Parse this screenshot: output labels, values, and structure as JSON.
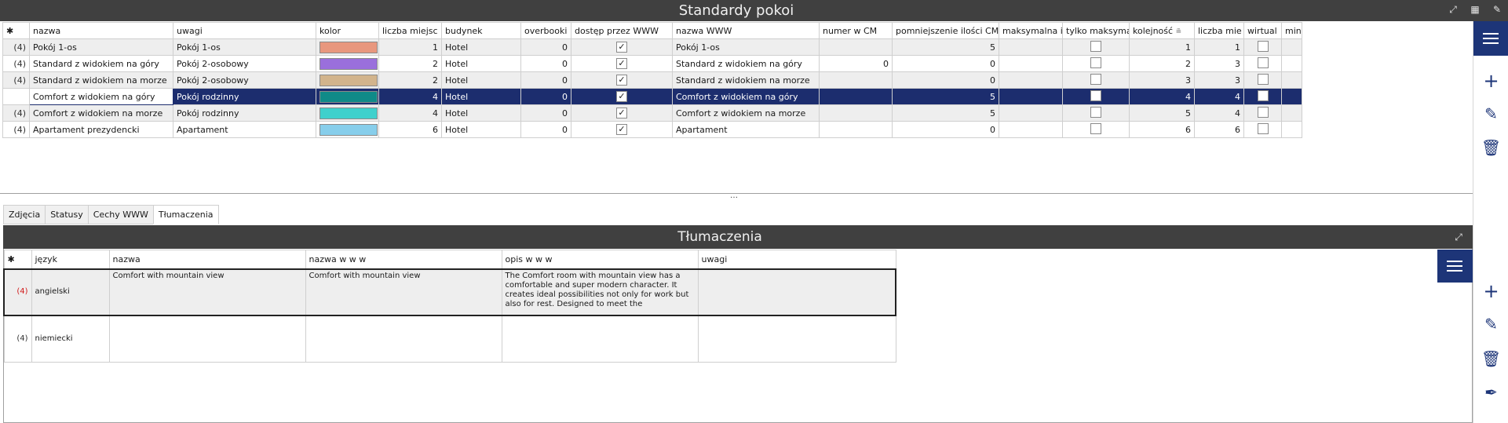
{
  "window": {
    "title": "Standardy pokoi",
    "icons": [
      "expand-icon",
      "grid-settings-icon",
      "tools-icon"
    ]
  },
  "grid": {
    "columns": [
      "nazwa",
      "uwagi",
      "kolor",
      "liczba miejsc",
      "budynek",
      "overbooki",
      "dostęp przez WWW",
      "nazwa WWW",
      "numer w CM",
      "pomniejszenie ilości CM",
      "maksymalna i",
      "tylko maksyma",
      "kolejność",
      "liczba mie",
      "wirtual",
      "min"
    ],
    "row_id_label": "(4)",
    "check_mark": "✓",
    "rows": [
      {
        "nazwa": "Pokój 1-os",
        "uwagi": "Pokój 1-os",
        "kolor": "#e8977e",
        "liczba_miejsc": "1",
        "budynek": "Hotel",
        "overbooki": "0",
        "dostep_www": true,
        "nazwa_www": "Pokój 1-os",
        "numer_cm": "",
        "pomniejszenie_cm": "5",
        "maksymalna": "",
        "tylko_maks": false,
        "kolejnosc": "1",
        "liczba_mie": "1",
        "wirtual": false
      },
      {
        "nazwa": "Standard z widokiem na góry",
        "uwagi": "Pokój 2-osobowy",
        "kolor": "#9a6fdc",
        "liczba_miejsc": "2",
        "budynek": "Hotel",
        "overbooki": "0",
        "dostep_www": true,
        "nazwa_www": "Standard z widokiem na góry",
        "numer_cm": "0",
        "pomniejszenie_cm": "0",
        "maksymalna": "",
        "tylko_maks": false,
        "kolejnosc": "2",
        "liczba_mie": "3",
        "wirtual": false
      },
      {
        "nazwa": "Standard z widokiem na morze",
        "uwagi": "Pokój 2-osobowy",
        "kolor": "#d2b48c",
        "liczba_miejsc": "2",
        "budynek": "Hotel",
        "overbooki": "0",
        "dostep_www": true,
        "nazwa_www": "Standard z widokiem na morze",
        "numer_cm": "",
        "pomniejszenie_cm": "0",
        "maksymalna": "",
        "tylko_maks": false,
        "kolejnosc": "3",
        "liczba_mie": "3",
        "wirtual": false
      },
      {
        "nazwa": "Comfort z widokiem na góry",
        "uwagi": "Pokój rodzinny",
        "kolor": "#0f8a88",
        "liczba_miejsc": "4",
        "budynek": "Hotel",
        "overbooki": "0",
        "dostep_www": true,
        "nazwa_www": "Comfort z widokiem na góry",
        "numer_cm": "",
        "pomniejszenie_cm": "5",
        "maksymalna": "",
        "tylko_maks": false,
        "kolejnosc": "4",
        "liczba_mie": "4",
        "wirtual": false,
        "selected": true
      },
      {
        "nazwa": "Comfort z widokiem na morze",
        "uwagi": "Pokój rodzinny",
        "kolor": "#3fd0cc",
        "liczba_miejsc": "4",
        "budynek": "Hotel",
        "overbooki": "0",
        "dostep_www": true,
        "nazwa_www": "Comfort z widokiem na morze",
        "numer_cm": "",
        "pomniejszenie_cm": "5",
        "maksymalna": "",
        "tylko_maks": false,
        "kolejnosc": "5",
        "liczba_mie": "4",
        "wirtual": false
      },
      {
        "nazwa": "Apartament prezydencki",
        "uwagi": "Apartament",
        "kolor": "#87ceeb",
        "liczba_miejsc": "6",
        "budynek": "Hotel",
        "overbooki": "0",
        "dostep_www": true,
        "nazwa_www": "Apartament",
        "numer_cm": "",
        "pomniejszenie_cm": "0",
        "maksymalna": "",
        "tylko_maks": false,
        "kolejnosc": "6",
        "liczba_mie": "6",
        "wirtual": false
      }
    ]
  },
  "tabs": [
    "Zdjęcia",
    "Statusy",
    "Cechy WWW",
    "Tłumaczenia"
  ],
  "active_tab": "Tłumaczenia",
  "translations": {
    "title": "Tłumaczenia",
    "columns": [
      "język",
      "nazwa",
      "nazwa w w w",
      "opis w w w",
      "uwagi"
    ],
    "rows": [
      {
        "id": "(4)",
        "jezyk": "angielski",
        "nazwa": "Comfort with mountain view",
        "nazwa_www": "Comfort with mountain view",
        "opis_www": "The Comfort room with mountain view has a comfortable and super modern character. It creates ideal possibilities not only for work but also for rest. Designed to meet the",
        "uwagi": ""
      },
      {
        "id": "(4)",
        "jezyk": "niemiecki",
        "nazwa": "",
        "nazwa_www": "",
        "opis_www": "",
        "uwagi": ""
      }
    ]
  },
  "colors": {
    "accent": "#1d3578",
    "selected_row": "#1c2d6e",
    "title_bar": "#404040",
    "star": "#f5a300",
    "red_id": "#d11a1a"
  }
}
